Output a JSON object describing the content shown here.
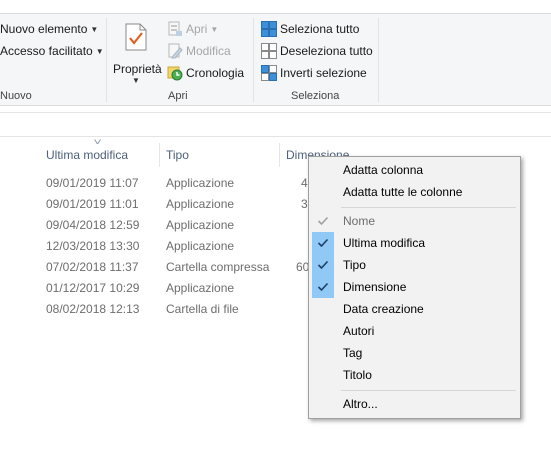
{
  "ribbon": {
    "nuovo": {
      "nuovo_elemento": "Nuovo elemento",
      "accesso_facilitato": "Accesso facilitato",
      "group_label": "Nuovo"
    },
    "apri": {
      "proprieta": "Proprietà",
      "apri": "Apri",
      "modifica": "Modifica",
      "cronologia": "Cronologia",
      "group_label": "Apri"
    },
    "seleziona": {
      "seleziona_tutto": "Seleziona tutto",
      "deseleziona_tutto": "Deseleziona tutto",
      "inverti_selezione": "Inverti selezione",
      "group_label": "Seleziona"
    }
  },
  "columns": {
    "ultima_modifica": "Ultima modifica",
    "tipo": "Tipo",
    "dimensione": "Dimensione"
  },
  "rows": [
    {
      "date": "09/01/2019 11:07",
      "type": "Applicazione",
      "size": "4"
    },
    {
      "date": "09/01/2019 11:01",
      "type": "Applicazione",
      "size": "3"
    },
    {
      "date": "09/04/2018 12:59",
      "type": "Applicazione",
      "size": ""
    },
    {
      "date": "12/03/2018 13:30",
      "type": "Applicazione",
      "size": ""
    },
    {
      "date": "07/02/2018 11:37",
      "type": "Cartella compressa",
      "size": "60"
    },
    {
      "date": "01/12/2017 10:29",
      "type": "Applicazione",
      "size": ""
    },
    {
      "date": "08/02/2018 12:13",
      "type": "Cartella di file",
      "size": ""
    }
  ],
  "menu": {
    "adatta_colonna": "Adatta colonna",
    "adatta_tutte": "Adatta tutte le colonne",
    "columns": [
      {
        "label": "Nome",
        "checked": true,
        "disabled": true
      },
      {
        "label": "Ultima modifica",
        "checked": true,
        "disabled": false
      },
      {
        "label": "Tipo",
        "checked": true,
        "disabled": false
      },
      {
        "label": "Dimensione",
        "checked": true,
        "disabled": false
      },
      {
        "label": "Data creazione",
        "checked": false,
        "disabled": false
      },
      {
        "label": "Autori",
        "checked": false,
        "disabled": false
      },
      {
        "label": "Tag",
        "checked": false,
        "disabled": false
      },
      {
        "label": "Titolo",
        "checked": false,
        "disabled": false
      }
    ],
    "altro": "Altro..."
  },
  "colors": {
    "ribbon_bg": "#f5f6f7",
    "header_text": "#4c607a",
    "row_text": "#6d6d6d",
    "menu_bg": "#f2f2f2",
    "check_highlight": "#90c8f6"
  }
}
